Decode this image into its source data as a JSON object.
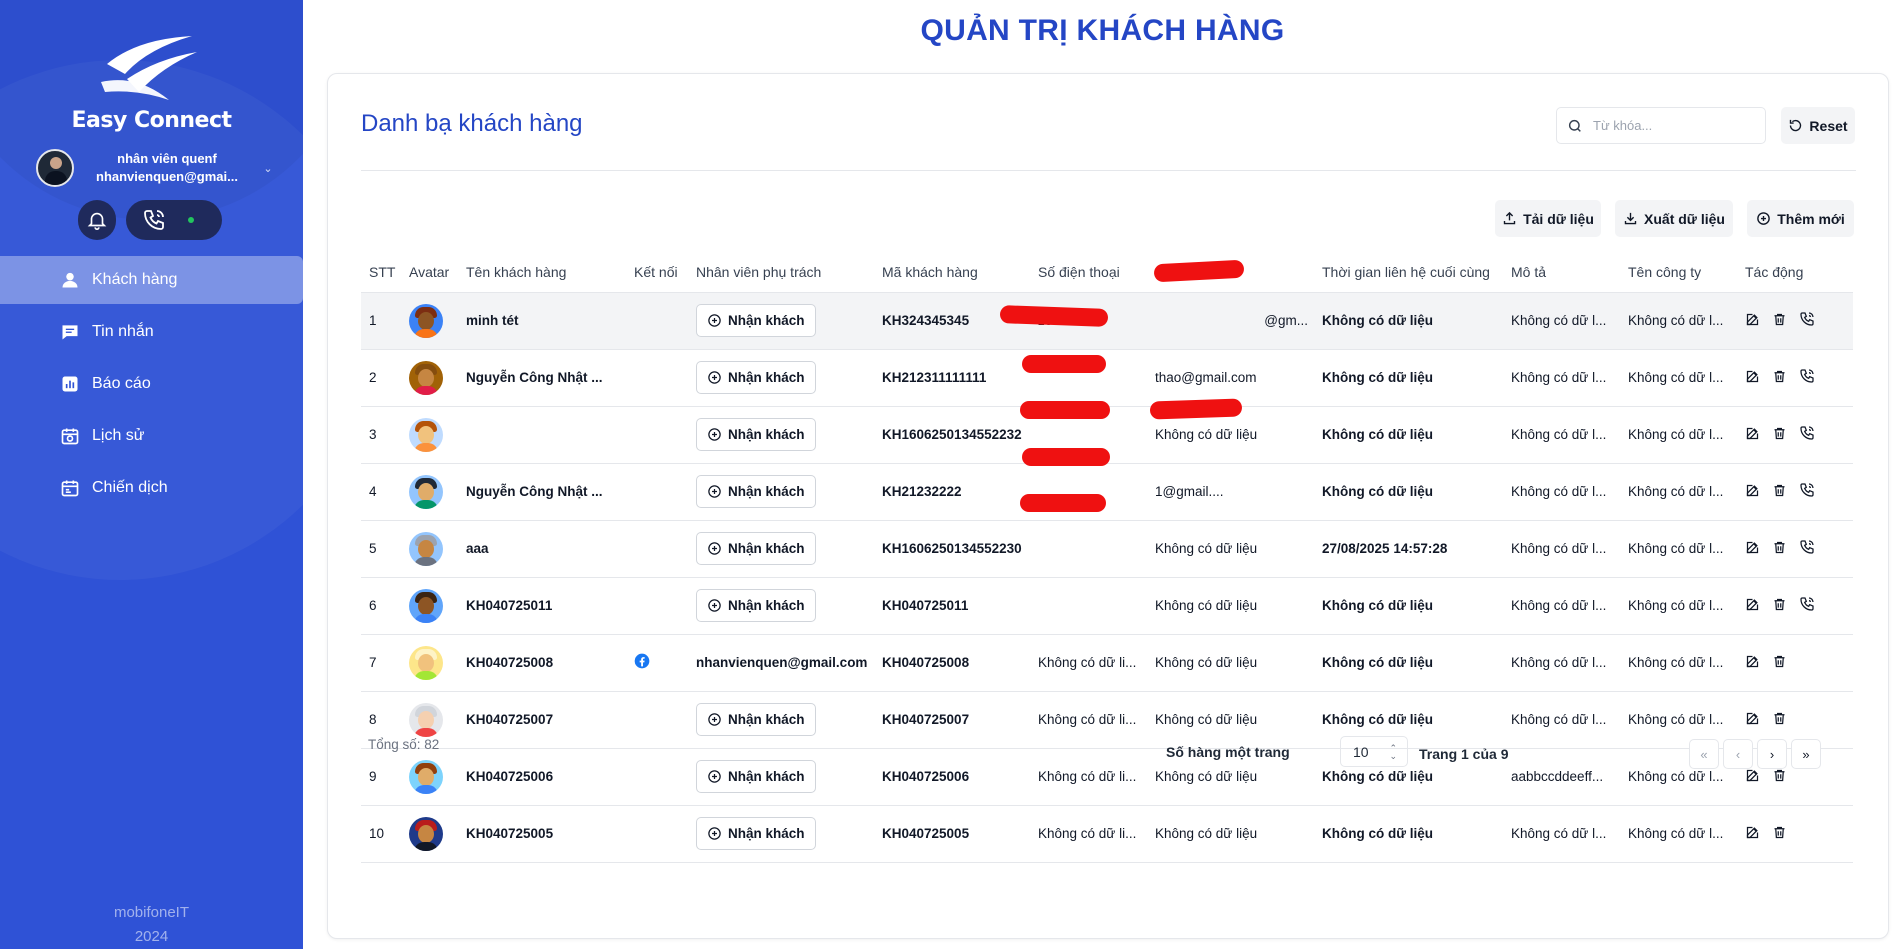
{
  "sidebar": {
    "logo_text": "Easy Connect",
    "user": {
      "name": "nhân viên quenf",
      "email": "nhanvienquen@gmai..."
    },
    "nav": [
      {
        "label": "Khách hàng",
        "icon": "user-icon",
        "active": true
      },
      {
        "label": "Tin nhắn",
        "icon": "chat-icon"
      },
      {
        "label": "Báo cáo",
        "icon": "report-icon"
      },
      {
        "label": "Lịch sử",
        "icon": "history-icon"
      },
      {
        "label": "Chiến dịch",
        "icon": "campaign-icon"
      }
    ],
    "brand_line1": "mobifoneIT",
    "brand_line2": "2024",
    "status_color": "#22c55e"
  },
  "header": {
    "title": "QUẢN TRỊ KHÁCH HÀNG"
  },
  "card": {
    "title": "Danh bạ khách hàng",
    "search_placeholder": "Từ khóa...",
    "reset_label": "Reset",
    "upload_label": "Tải dữ liệu",
    "export_label": "Xuất dữ liệu",
    "add_label": "Thêm mới"
  },
  "table": {
    "columns": [
      "STT",
      "Avatar",
      "Tên khách hàng",
      "Kết nối",
      "Nhân viên phụ trách",
      "Mã khách hàng",
      "Số điện thoại",
      "Email",
      "Thời gian liên hệ cuối cùng",
      "Mô tả",
      "Tên công ty",
      "Tác động"
    ],
    "rows": [
      {
        "stt": "1",
        "name": "minh tét",
        "connect": "",
        "staff": "Nhận khách",
        "code": "KH324345345",
        "phone": "z64515231",
        "email": "@gm...",
        "last": "Không có dữ liệu",
        "desc": "Không có dữ l...",
        "company": "Không có dữ l...",
        "call": true
      },
      {
        "stt": "2",
        "name": "Nguyễn Công Nhật ...",
        "connect": "",
        "staff": "Nhận khách",
        "code": "KH212311111111",
        "phone": "",
        "email": "thao@gmail.com",
        "last": "Không có dữ liệu",
        "desc": "Không có dữ l...",
        "company": "Không có dữ l...",
        "call": true
      },
      {
        "stt": "3",
        "name": "",
        "connect": "",
        "staff": "Nhận khách",
        "code": "KH1606250134552232",
        "phone": "",
        "email": "Không có dữ liệu",
        "last": "Không có dữ liệu",
        "desc": "Không có dữ l...",
        "company": "Không có dữ l...",
        "call": true
      },
      {
        "stt": "4",
        "name": "Nguyễn Công Nhật ...",
        "connect": "",
        "staff": "Nhận khách",
        "code": "KH21232222",
        "phone": "",
        "email": "1@gmail....",
        "last": "Không có dữ liệu",
        "desc": "Không có dữ l...",
        "company": "Không có dữ l...",
        "call": true
      },
      {
        "stt": "5",
        "name": "aaa",
        "connect": "",
        "staff": "Nhận khách",
        "code": "KH1606250134552230",
        "phone": "",
        "email": "Không có dữ liệu",
        "last": "27/08/2025 14:57:28",
        "desc": "Không có dữ l...",
        "company": "Không có dữ l...",
        "call": true
      },
      {
        "stt": "6",
        "name": "KH040725011",
        "connect": "",
        "staff": "Nhận khách",
        "code": "KH040725011",
        "phone": "",
        "email": "Không có dữ liệu",
        "last": "Không có dữ liệu",
        "desc": "Không có dữ l...",
        "company": "Không có dữ l...",
        "call": true
      },
      {
        "stt": "7",
        "name": "KH040725008",
        "connect": "facebook",
        "staff": "nhanvienquen@gmail.com",
        "code": "KH040725008",
        "phone": "Không có dữ li...",
        "email": "Không có dữ liệu",
        "last": "Không có dữ liệu",
        "desc": "Không có dữ l...",
        "company": "Không có dữ l...",
        "call": false
      },
      {
        "stt": "8",
        "name": "KH040725007",
        "connect": "",
        "staff": "Nhận khách",
        "code": "KH040725007",
        "phone": "Không có dữ li...",
        "email": "Không có dữ liệu",
        "last": "Không có dữ liệu",
        "desc": "Không có dữ l...",
        "company": "Không có dữ l...",
        "call": false
      },
      {
        "stt": "9",
        "name": "KH040725006",
        "connect": "",
        "staff": "Nhận khách",
        "code": "KH040725006",
        "phone": "Không có dữ li...",
        "email": "Không có dữ liệu",
        "last": "Không có dữ liệu",
        "desc": "aabbccddeeff...",
        "company": "Không có dữ l...",
        "call": false
      },
      {
        "stt": "10",
        "name": "KH040725005",
        "connect": "",
        "staff": "Nhận khách",
        "code": "KH040725005",
        "phone": "Không có dữ li...",
        "email": "Không có dữ liệu",
        "last": "Không có dữ liệu",
        "desc": "Không có dữ l...",
        "company": "Không có dữ l...",
        "call": false
      }
    ]
  },
  "footer": {
    "total": "Tổng số: 82",
    "rows_label": "Số hàng một trang",
    "rows_value": "10",
    "page_info": "Trang 1 của 9"
  }
}
